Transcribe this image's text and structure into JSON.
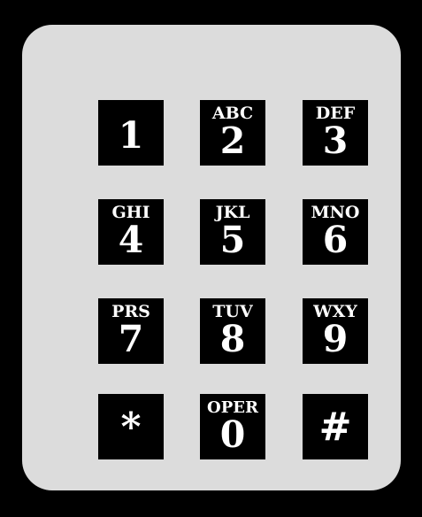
{
  "keypad": {
    "keys": [
      {
        "digit": "1",
        "letters": ""
      },
      {
        "digit": "2",
        "letters": "ABC"
      },
      {
        "digit": "3",
        "letters": "DEF"
      },
      {
        "digit": "4",
        "letters": "GHI"
      },
      {
        "digit": "5",
        "letters": "JKL"
      },
      {
        "digit": "6",
        "letters": "MNO"
      },
      {
        "digit": "7",
        "letters": "PRS"
      },
      {
        "digit": "8",
        "letters": "TUV"
      },
      {
        "digit": "9",
        "letters": "WXY"
      },
      {
        "digit": "*",
        "letters": ""
      },
      {
        "digit": "0",
        "letters": "OPER"
      },
      {
        "digit": "#",
        "letters": ""
      }
    ]
  },
  "colors": {
    "background": "#000000",
    "panel": "#dcdcdc",
    "key": "#000000",
    "key_text": "#ffffff"
  }
}
